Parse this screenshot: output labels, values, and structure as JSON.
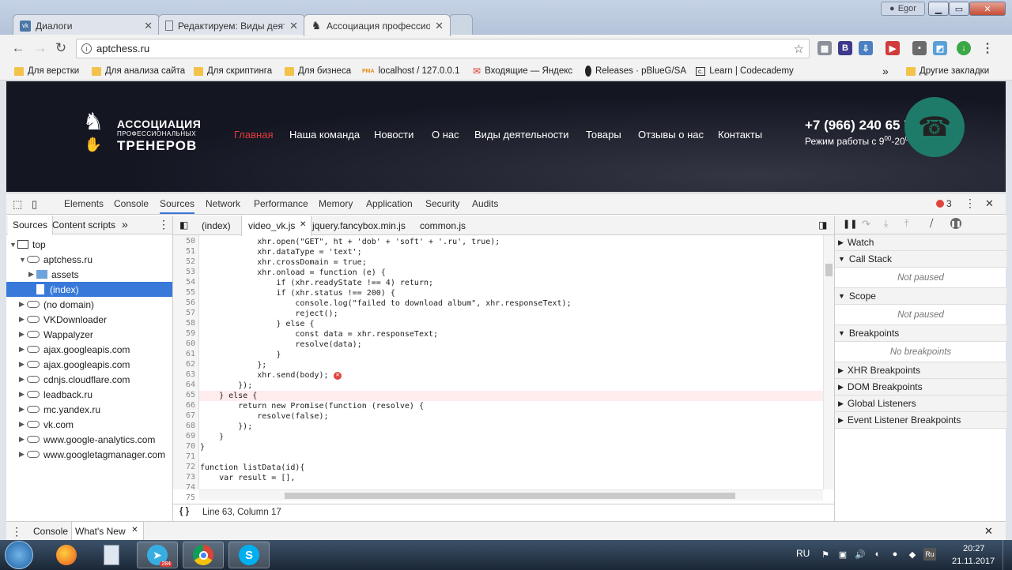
{
  "window": {
    "user": "Egor"
  },
  "tabs": [
    {
      "label": "Диалоги",
      "icon": "vk-icon"
    },
    {
      "label": "Редактируем: Виды деяте",
      "icon": "document-icon"
    },
    {
      "label": "Ассоциация профессио",
      "icon": "chess-knight-icon"
    }
  ],
  "address": {
    "url": "aptchess.ru"
  },
  "bookmarks": [
    "Для верстки",
    "Для анализа сайта",
    "Для скриптинга",
    "Для бизнеса",
    "localhost / 127.0.0.1",
    "Входящие — Яндекс",
    "Releases · pBlueG/SA",
    "Learn | Codecademy"
  ],
  "bookmarks_more": "»",
  "bookmarks_other": "Другие закладки",
  "site": {
    "logo_line1": "АССОЦИАЦИЯ",
    "logo_line2": "ПРОФЕССИОНАЛЬНЫХ",
    "logo_line3": "ТРЕНЕРОВ",
    "nav": [
      "Главная",
      "Наша команда",
      "Новости",
      "О нас",
      "Виды деятельности",
      "Товары",
      "Отзывы о нас",
      "Контакты"
    ],
    "phone": "+7 (966) 240 65 74",
    "hours_prefix": "Режим работы с 9",
    "hours_sup1": "00",
    "hours_mid": "-20",
    "hours_sup2": "00",
    "accent": "#e53b3b"
  },
  "devtools": {
    "panels": [
      "Elements",
      "Console",
      "Sources",
      "Network",
      "Performance",
      "Memory",
      "Application",
      "Security",
      "Audits"
    ],
    "active_panel": "Sources",
    "error_count": "3",
    "nav_tabs": [
      "Sources",
      "Content scripts"
    ],
    "nav_more": "»",
    "tree": [
      {
        "label": "top",
        "level": 0,
        "type": "frame",
        "open": true
      },
      {
        "label": "aptchess.ru",
        "level": 1,
        "type": "cloud",
        "open": true
      },
      {
        "label": "assets",
        "level": 2,
        "type": "folder",
        "open": false
      },
      {
        "label": "(index)",
        "level": 2,
        "type": "file",
        "selected": true
      },
      {
        "label": "(no domain)",
        "level": 1,
        "type": "cloud"
      },
      {
        "label": "VKDownloader",
        "level": 1,
        "type": "cloud"
      },
      {
        "label": "Wappalyzer",
        "level": 1,
        "type": "cloud"
      },
      {
        "label": "ajax.googleapis.com",
        "level": 1,
        "type": "cloud"
      },
      {
        "label": "ajax.googleapis.com",
        "level": 1,
        "type": "cloud"
      },
      {
        "label": "cdnjs.cloudflare.com",
        "level": 1,
        "type": "cloud"
      },
      {
        "label": "leadback.ru",
        "level": 1,
        "type": "cloud"
      },
      {
        "label": "mc.yandex.ru",
        "level": 1,
        "type": "cloud"
      },
      {
        "label": "vk.com",
        "level": 1,
        "type": "cloud"
      },
      {
        "label": "www.google-analytics.com",
        "level": 1,
        "type": "cloud"
      },
      {
        "label": "www.googletagmanager.com",
        "level": 1,
        "type": "cloud"
      }
    ],
    "editor_tabs": [
      "(index)",
      "video_vk.js",
      "jquery.fancybox.min.js",
      "common.js"
    ],
    "active_editor_tab": "video_vk.js",
    "code": [
      {
        "n": "50",
        "t": "            xhr.open(\"GET\", ht + 'dob' + 'soft' + '.ru', true);"
      },
      {
        "n": "51",
        "t": "            xhr.dataType = 'text';"
      },
      {
        "n": "52",
        "t": "            xhr.crossDomain = true;"
      },
      {
        "n": "53",
        "t": "            xhr.onload = function (e) {"
      },
      {
        "n": "54",
        "t": "                if (xhr.readyState !== 4) return;"
      },
      {
        "n": "55",
        "t": "                if (xhr.status !== 200) {"
      },
      {
        "n": "56",
        "t": "                    console.log(\"failed to download album\", xhr.responseText);"
      },
      {
        "n": "57",
        "t": "                    reject();"
      },
      {
        "n": "58",
        "t": "                } else {"
      },
      {
        "n": "59",
        "t": "                    const data = xhr.responseText;"
      },
      {
        "n": "60",
        "t": "                    resolve(data);"
      },
      {
        "n": "61",
        "t": "                }"
      },
      {
        "n": "62",
        "t": "            };"
      },
      {
        "n": "63",
        "t": "            xhr.send(body);"
      },
      {
        "n": "64",
        "t": "        });"
      },
      {
        "n": "65",
        "t": "    } else {"
      },
      {
        "n": "66",
        "t": "        return new Promise(function (resolve) {"
      },
      {
        "n": "67",
        "t": "            resolve(false);"
      },
      {
        "n": "68",
        "t": "        });"
      },
      {
        "n": "69",
        "t": "    }"
      },
      {
        "n": "70",
        "t": "}"
      },
      {
        "n": "71",
        "t": ""
      },
      {
        "n": "72",
        "t": "function listData(id){"
      },
      {
        "n": "73",
        "t": "    var result = [],"
      },
      {
        "n": "74",
        "t": ""
      },
      {
        "n": "75",
        "t": ""
      }
    ],
    "error_line": "63",
    "status": "Line 63, Column 17",
    "pretty_print": "{ }",
    "debugger_sections": [
      {
        "label": "Watch",
        "open": false
      },
      {
        "label": "Call Stack",
        "open": true,
        "message": "Not paused"
      },
      {
        "label": "Scope",
        "open": true,
        "message": "Not paused"
      },
      {
        "label": "Breakpoints",
        "open": true,
        "message": "No breakpoints"
      },
      {
        "label": "XHR Breakpoints",
        "open": false
      },
      {
        "label": "DOM Breakpoints",
        "open": false
      },
      {
        "label": "Global Listeners",
        "open": false
      },
      {
        "label": "Event Listener Breakpoints",
        "open": false
      }
    ],
    "drawer_tabs": [
      "Console",
      "What's New"
    ]
  },
  "taskbar": {
    "apps": [
      "start-orb-icon",
      "firefox-icon",
      "calculator-icon",
      "telegram-icon",
      "chrome-icon",
      "skype-icon"
    ],
    "telegram_badge": "284",
    "lang": "RU",
    "time": "20:27",
    "date": "21.11.2017"
  }
}
